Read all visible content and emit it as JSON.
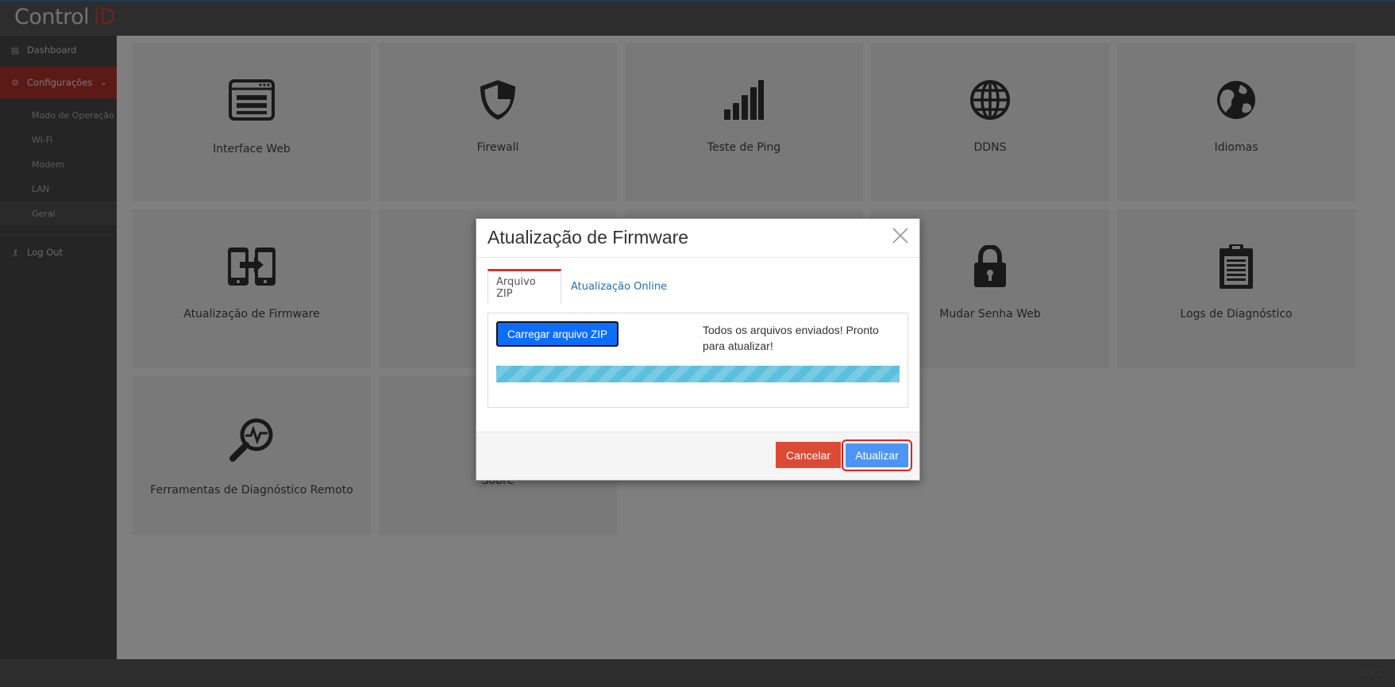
{
  "app": {
    "logo_text": "Control",
    "logo_accent": "iD"
  },
  "sidebar": {
    "items": [
      {
        "label": "Dashboard",
        "icon": "dashboard-icon"
      },
      {
        "label": "Configurações",
        "icon": "cogs-icon",
        "expanded": true
      },
      {
        "label": "Log Out",
        "icon": "key-icon"
      }
    ],
    "sub_items": [
      {
        "label": "Modo de Operação"
      },
      {
        "label": "Wi-Fi"
      },
      {
        "label": "Modem"
      },
      {
        "label": "LAN"
      },
      {
        "label": "Geral",
        "current": true
      }
    ]
  },
  "tiles": [
    {
      "label": "Interface Web",
      "icon": "browser-window-icon"
    },
    {
      "label": "Firewall",
      "icon": "shield-icon"
    },
    {
      "label": "Teste de Ping",
      "icon": "signal-bars-icon"
    },
    {
      "label": "DDNS",
      "icon": "globe-icon"
    },
    {
      "label": "Idiomas",
      "icon": "earth-icon"
    },
    {
      "label": "Atualização de Firmware",
      "icon": "firmware-transfer-icon"
    },
    {
      "label": "",
      "icon": ""
    },
    {
      "label": "",
      "icon": ""
    },
    {
      "label": "Mudar Senha Web",
      "icon": "lock-icon"
    },
    {
      "label": "Logs de Diagnóstico",
      "icon": "clipboard-icon"
    },
    {
      "label": "Ferramentas de Diagnóstico Remoto",
      "icon": "magnifier-pulse-icon"
    },
    {
      "label": "Sobre",
      "icon": ""
    }
  ],
  "modal": {
    "title": "Atualização de Firmware",
    "tabs": [
      {
        "label": "Arquivo ZIP",
        "active": true
      },
      {
        "label": "Atualização Online",
        "active": false
      }
    ],
    "upload_button_label": "Carregar arquivo ZIP",
    "status_message": "Todos os arquivos enviados! Pronto para atualizar!",
    "progress_fraction": 1.0,
    "cancel_label": "Cancelar",
    "update_label": "Atualizar"
  },
  "footer": {
    "version": "1.4.27"
  },
  "colors": {
    "accent_red": "#b7342c",
    "progress": "#5bc0de",
    "primary_button": "#0d6efd",
    "update_button": "#4c95f5",
    "cancel_button": "#dc4a36"
  }
}
